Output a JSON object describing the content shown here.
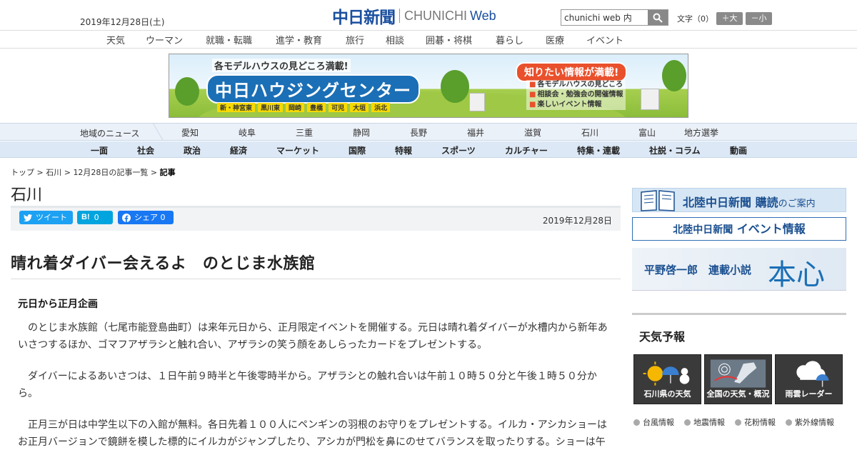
{
  "header": {
    "date": "2019年12月28日(土)",
    "logo_ja": "中日新聞",
    "logo_en": "CHUNICHI",
    "logo_web": "Web",
    "search_value": "chunichi web 内",
    "fontsize_label": "文字（0）",
    "font_larger": "＋大",
    "font_smaller": "－小"
  },
  "topnav": [
    "天気",
    "ウーマン",
    "就職・転職",
    "進学・教育",
    "旅行",
    "相談",
    "囲碁・将棋",
    "暮らし",
    "医療",
    "イベント"
  ],
  "banner": {
    "line1": "各モデルハウスの見どころ満載!",
    "line2": "中日ハウジングセンター",
    "places": [
      "新・神宮東",
      "黒川東",
      "岡崎",
      "豊橋",
      "可児",
      "大垣",
      "浜北"
    ],
    "tagline": "知りたい情報が満載!",
    "points": [
      "各モデルハウスの見どころ",
      "相談会・勉強会の開催情報",
      "楽しいイベント情報"
    ]
  },
  "regional": {
    "label": "地域のニュース",
    "items": [
      "愛知",
      "岐阜",
      "三重",
      "静岡",
      "長野",
      "福井",
      "滋賀",
      "石川",
      "富山",
      "地方選挙"
    ]
  },
  "categories": [
    "一面",
    "社会",
    "政治",
    "経済",
    "マーケット",
    "国際",
    "特報",
    "スポーツ",
    "カルチャー",
    "特集・連載",
    "社説・コラム",
    "動画"
  ],
  "breadcrumb": {
    "top": "トップ",
    "sep": " > ",
    "pref": "石川",
    "list": "12月28日の記事一覧",
    "current": "記事"
  },
  "section_title": "石川",
  "share": {
    "tweet": "ツイート",
    "hatena": "0",
    "facebook": "シェア 0"
  },
  "article": {
    "date": "2019年12月28日",
    "headline": "晴れ着ダイバー会えるよ　のとじま水族館",
    "subhead": "元日から正月企画",
    "paragraphs": [
      "のとじま水族館（七尾市能登島曲町）は来年元日から、正月限定イベントを開催する。元日は晴れ着ダイバーが水槽内から新年あいさつするほか、ゴマフアザラシと触れ合い、アザラシの笑う顔をあしらったカードをプレゼントする。",
      "ダイバーによるあいさつは、１日午前９時半と午後零時半から。アザラシとの触れ合いは午前１０時５０分と午後１時５０分から。",
      "正月三が日は中学生以下の入館が無料。各日先着１００人にペンギンの羽根のお守りをプレゼントする。イルカ・アシカショーはお正月バージョンで鏡餅を模した標的にイルカがジャンプしたり、アシカが門松を鼻にのせてバランスを取ったりする。ショーは午"
    ]
  },
  "sidebar": {
    "subscribe": "北陸中日新聞 購読",
    "subscribe_suffix": "のご案内",
    "event": "北陸中日新聞",
    "event_suffix": "イベント情報",
    "novel_author": "平野啓一郎　連載小説",
    "novel_title": "本心",
    "weather_title": "天気予報",
    "weather_tiles": [
      "石川県の天気",
      "全国の天気・概況",
      "雨雲レーダー"
    ],
    "weather_links": [
      "台風情報",
      "地震情報",
      "花粉情報",
      "紫外線情報"
    ]
  },
  "colors": {
    "brand": "#1a4fa0",
    "twitter": "#1da1f2",
    "hatena": "#00a4de",
    "facebook": "#1877f2"
  }
}
